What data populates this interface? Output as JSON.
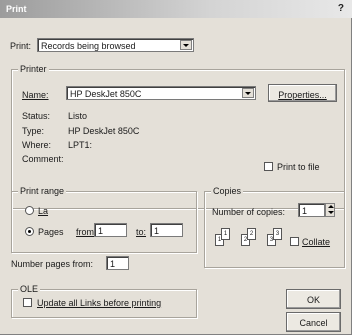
{
  "window": {
    "title": "Print",
    "help_glyph": "?"
  },
  "print_what": {
    "label": "Print:",
    "value": "Records being browsed"
  },
  "printer": {
    "group_label": "Printer",
    "name_label": "Name:",
    "name_value": "HP DeskJet 850C",
    "properties_label": "Properties...",
    "status_label": "Status:",
    "status_value": "Listo",
    "type_label": "Type:",
    "type_value": "HP DeskJet 850C",
    "where_label": "Where:",
    "where_value": "LPT1:",
    "comment_label": "Comment:",
    "print_to_file_label": "Print to file"
  },
  "print_range": {
    "group_label": "Print range",
    "all_label": "La",
    "pages_label": "Pages",
    "from_label": "from:",
    "from_value": "1",
    "to_label": "to:",
    "to_value": "1",
    "selected": "pages"
  },
  "copies": {
    "group_label": "Copies",
    "number_label": "Number of copies:",
    "number_value": "1",
    "collate_label": "Collate",
    "pages": [
      "1",
      "1",
      "2",
      "2",
      "3",
      "3"
    ]
  },
  "number_pages": {
    "label": "Number pages from:",
    "value": "1"
  },
  "ole": {
    "group_label": "OLE",
    "update_label": "Update all Links before printing"
  },
  "buttons": {
    "ok": "OK",
    "cancel": "Cancel"
  }
}
